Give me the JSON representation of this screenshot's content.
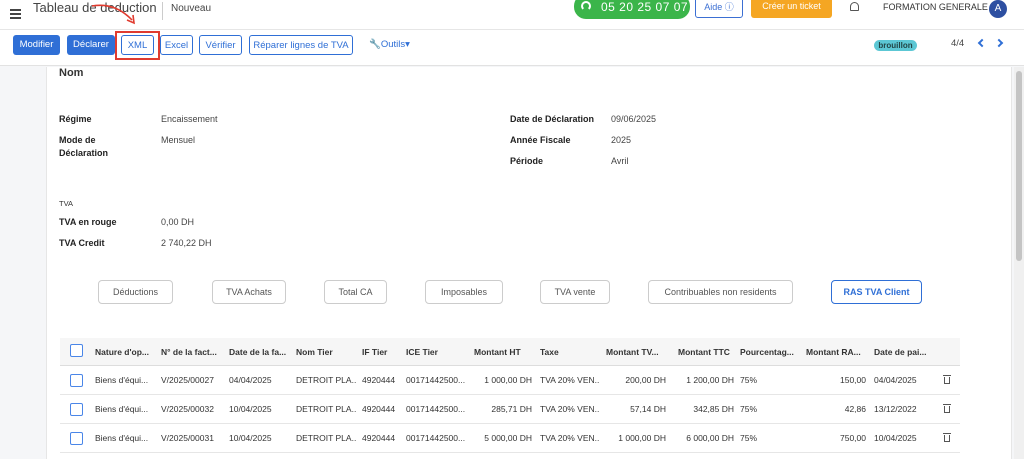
{
  "header": {
    "app_title": "Tableau de deduction",
    "status": "Nouveau",
    "phone": "05 20 25 07 07",
    "help_label": "Aide",
    "help_icon": "ⓘ",
    "ticket_label": "Créer un ticket",
    "organization": "FORMATION GENERALE",
    "avatar_initial": "A"
  },
  "toolbar": {
    "modifier": "Modifier",
    "declarer": "Déclarer",
    "xml": "XML",
    "excel": "Excel",
    "verifier": "Vérifier",
    "reparer": "Réparer lignes de TVA",
    "outils": "Outils",
    "draft_badge": "brouillon",
    "pager": "4/4"
  },
  "form": {
    "name_label": "Nom",
    "regime_label": "Régime",
    "regime_value": "Encaissement",
    "mode_label": "Mode de Déclaration",
    "mode_value": "Mensuel",
    "date_decl_label": "Date de Déclaration",
    "date_decl_value": "09/06/2025",
    "annee_label": "Année Fiscale",
    "annee_value": "2025",
    "periode_label": "Période",
    "periode_value": "Avril",
    "tva_section": "TVA",
    "tva_rouge_label": "TVA en rouge",
    "tva_rouge_value": "0,00 DH",
    "tva_credit_label": "TVA Credit",
    "tva_credit_value": "2 740,22 DH"
  },
  "tabs": [
    "Déductions",
    "TVA Achats",
    "Total CA",
    "Imposables",
    "TVA vente",
    "Contribuables non residents",
    "RAS TVA Client"
  ],
  "table": {
    "columns": [
      "Nature d'op...",
      "N° de la fact...",
      "Date de la fa...",
      "Nom Tier",
      "IF Tier",
      "ICE Tier",
      "Montant HT",
      "Taxe",
      "Montant TV...",
      "Montant TTC",
      "Pourcentag...",
      "Montant RA...",
      "Date de pai..."
    ],
    "rows": [
      [
        "Biens d'équi...",
        "V/2025/00027",
        "04/04/2025",
        "DETROIT PLA...",
        "4920444",
        "00171442500...",
        "1 000,00 DH",
        "TVA 20% VEN...",
        "200,00 DH",
        "1 200,00 DH",
        "75%",
        "150,00",
        "04/04/2025"
      ],
      [
        "Biens d'équi...",
        "V/2025/00032",
        "10/04/2025",
        "DETROIT PLA...",
        "4920444",
        "00171442500...",
        "285,71 DH",
        "TVA 20% VEN...",
        "57,14 DH",
        "342,85 DH",
        "75%",
        "42,86",
        "13/12/2022"
      ],
      [
        "Biens d'équi...",
        "V/2025/00031",
        "10/04/2025",
        "DETROIT PLA...",
        "4920444",
        "00171442500...",
        "5 000,00 DH",
        "TVA 20% VEN...",
        "1 000,00 DH",
        "6 000,00 DH",
        "75%",
        "750,00",
        "10/04/2025"
      ]
    ]
  },
  "colors": {
    "primary": "#2f6fd6",
    "phone_green": "#3bb54a",
    "ticket_orange": "#f5a623",
    "highlight_red": "#e03b2f",
    "draft_badge": "#5cc7d4"
  }
}
